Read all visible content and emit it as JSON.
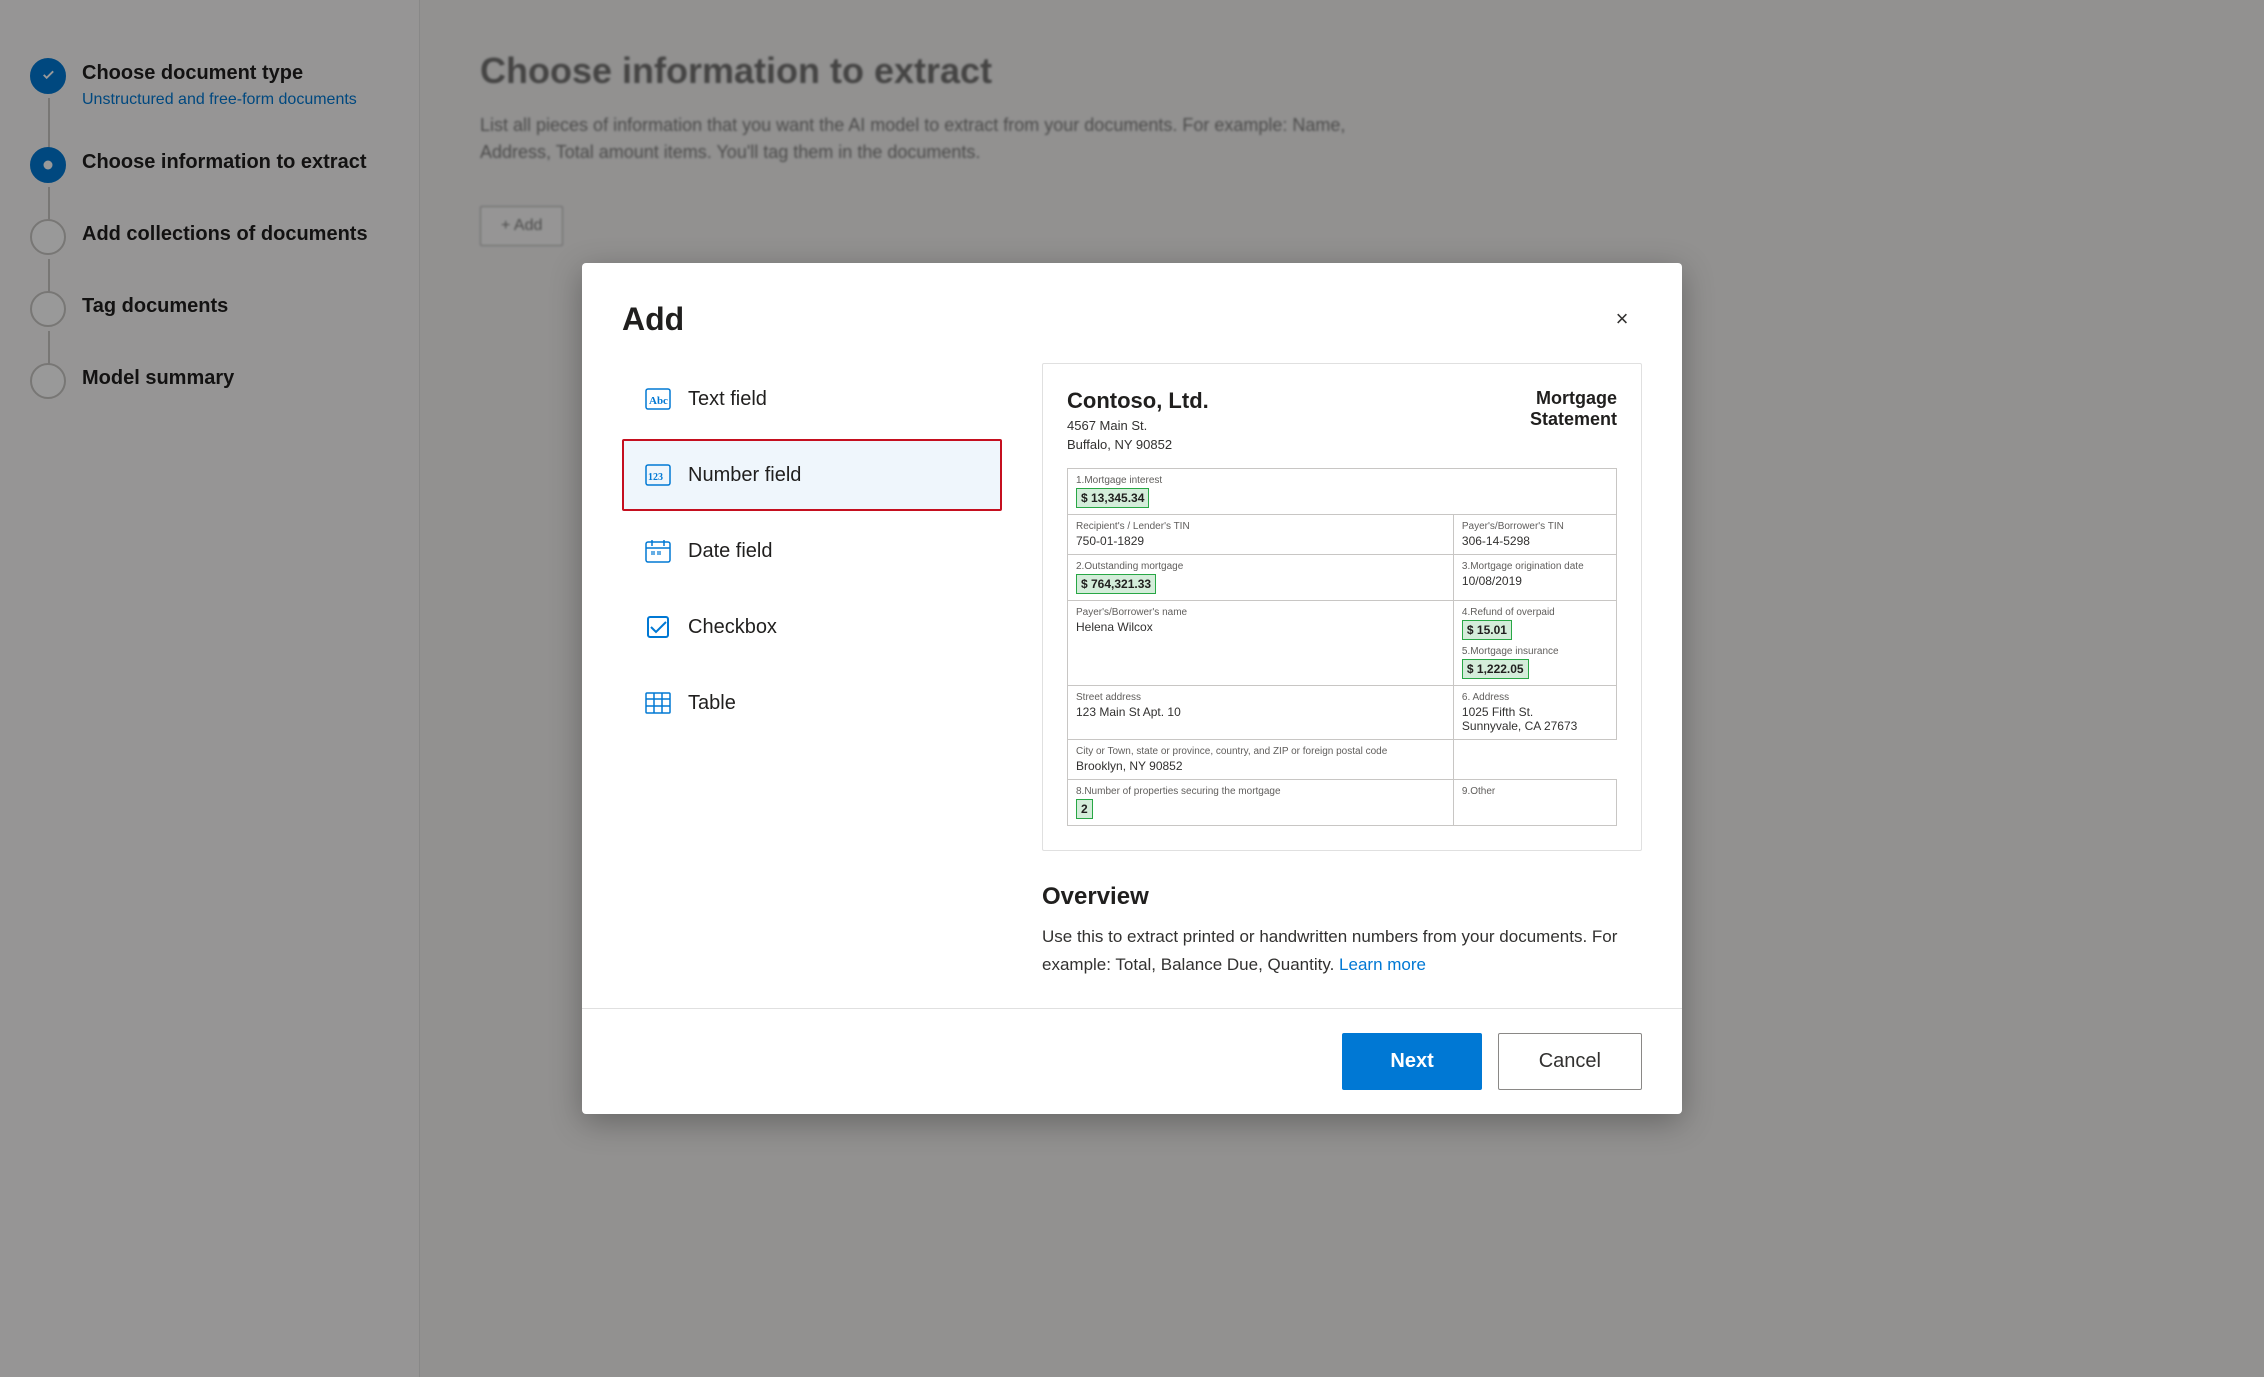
{
  "sidebar": {
    "steps": [
      {
        "id": "choose-document-type",
        "title": "Choose document type",
        "subtitle": "Unstructured and free-form documents",
        "state": "completed"
      },
      {
        "id": "choose-information",
        "title": "Choose information to extract",
        "subtitle": "",
        "state": "active"
      },
      {
        "id": "add-collections",
        "title": "Add collections of documents",
        "subtitle": "",
        "state": "inactive"
      },
      {
        "id": "tag-documents",
        "title": "Tag documents",
        "subtitle": "",
        "state": "inactive"
      },
      {
        "id": "model-summary",
        "title": "Model summary",
        "subtitle": "",
        "state": "inactive"
      }
    ]
  },
  "main": {
    "title": "Choose information to extract",
    "description": "List all pieces of information that you want the AI model to extract from your documents. For example: Name, Address, Total amount items. You'll tag them in the documents.",
    "add_button_label": "+ Add"
  },
  "modal": {
    "title": "Add",
    "close_label": "×",
    "options": [
      {
        "id": "text-field",
        "label": "Text field",
        "icon_type": "abc",
        "selected": false
      },
      {
        "id": "number-field",
        "label": "Number field",
        "icon_type": "123",
        "selected": true
      },
      {
        "id": "date-field",
        "label": "Date field",
        "icon_type": "date",
        "selected": false
      },
      {
        "id": "checkbox",
        "label": "Checkbox",
        "icon_type": "checkbox",
        "selected": false
      },
      {
        "id": "table",
        "label": "Table",
        "icon_type": "table",
        "selected": false
      }
    ],
    "preview": {
      "company": "Contoso, Ltd.",
      "address_line1": "4567 Main St.",
      "address_line2": "Buffalo, NY 90852",
      "statement_title": "Mortgage\nStatement",
      "fields": [
        {
          "label": "1.Mortgage interest",
          "value": "$ 13,345.34",
          "highlighted": true
        },
        {
          "label": "Recipient's / Lender's TIN",
          "value": "750-01-1829",
          "highlighted": false
        },
        {
          "label": "Payer's/Borrower's TIN",
          "value": "306-14-5298",
          "highlighted": false
        },
        {
          "label": "2.Outstanding mortgage",
          "value": "$ 764,321.33",
          "highlighted": true
        },
        {
          "label": "3.Mortgage origination date",
          "value": "10/08/2019",
          "highlighted": false
        },
        {
          "label": "Payer's/Borrower's name",
          "value": "Helena Wilcox",
          "highlighted": false
        },
        {
          "label": "4.Refund of overpaid",
          "value": "$ 15.01",
          "highlighted": true
        },
        {
          "label": "5.Mortgage insurance",
          "value": "$ 1,222.05",
          "highlighted": true
        },
        {
          "label": "Street address",
          "value": "123 Main St Apt. 10",
          "highlighted": false
        },
        {
          "label": "6. Address",
          "value": "1025 Fifth St.\nSunnyvale, CA 27673",
          "highlighted": false
        },
        {
          "label": "City or Town, state or province, country, and ZIP or foreign postal code",
          "value": "Brooklyn, NY 90852",
          "highlighted": false
        },
        {
          "label": "8.Number of properties securing the mortgage",
          "value": "2",
          "highlighted": true
        },
        {
          "label": "9.Other",
          "value": "",
          "highlighted": false
        }
      ]
    },
    "overview": {
      "title": "Overview",
      "description": "Use this to extract printed or handwritten numbers from your documents. For example: Total, Balance Due, Quantity.",
      "learn_more_label": "Learn more"
    },
    "footer": {
      "next_label": "Next",
      "cancel_label": "Cancel"
    }
  }
}
